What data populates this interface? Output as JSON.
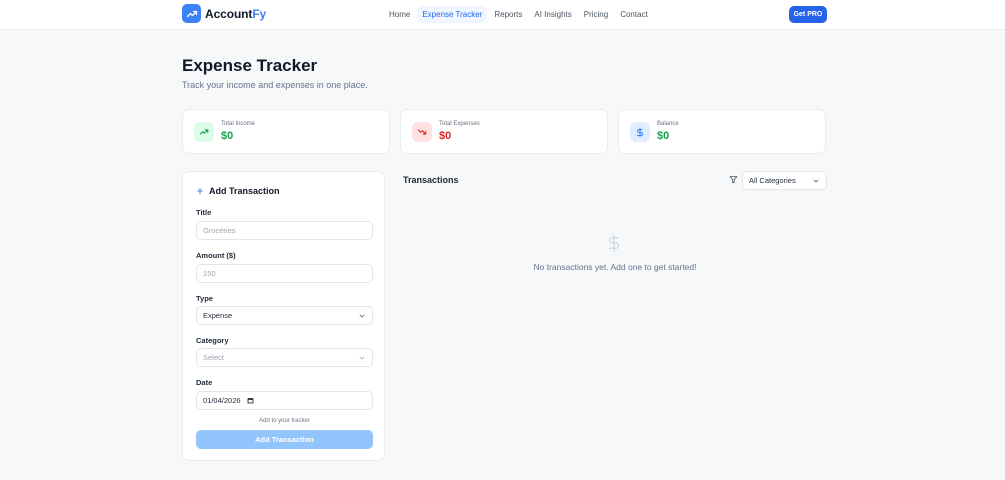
{
  "header": {
    "logo_main": "Account",
    "logo_accent": "Fy",
    "nav": [
      "Home",
      "Expense Tracker",
      "Reports",
      "AI Insights",
      "Pricing",
      "Contact"
    ],
    "active_nav": "Expense Tracker",
    "cta_label": "Get PRO"
  },
  "page": {
    "title": "Expense Tracker",
    "subtitle": "Track your income and expenses in one place."
  },
  "stats": {
    "income": {
      "label": "Total Income",
      "value": "$0",
      "color": "#16a34a",
      "icon": "trending-up-icon"
    },
    "expenses": {
      "label": "Total Expenses",
      "value": "$0",
      "color": "#dc2626",
      "icon": "trending-down-icon"
    },
    "balance": {
      "label": "Balance",
      "value": "$0",
      "color": "#16a34a",
      "icon": "dollar-icon"
    }
  },
  "form": {
    "heading": "Add Transaction",
    "title_label": "Title",
    "title_placeholder": "Groceries",
    "amount_label": "Amount ($)",
    "amount_placeholder": "150",
    "type_label": "Type",
    "type_value": "Expense",
    "category_label": "Category",
    "category_value": "Select",
    "date_label": "Date",
    "date_value": "01/04/2026",
    "hint": "Add to your tracker",
    "submit_label": "Add Transaction"
  },
  "transactions": {
    "title": "Transactions",
    "filter_value": "All Categories",
    "empty_message": "No transactions yet. Add one to get started!"
  },
  "colors": {
    "accent": "#3b82f6",
    "income": "#16a34a",
    "expense": "#dc2626",
    "submit_disabled": "#93c5fd"
  }
}
